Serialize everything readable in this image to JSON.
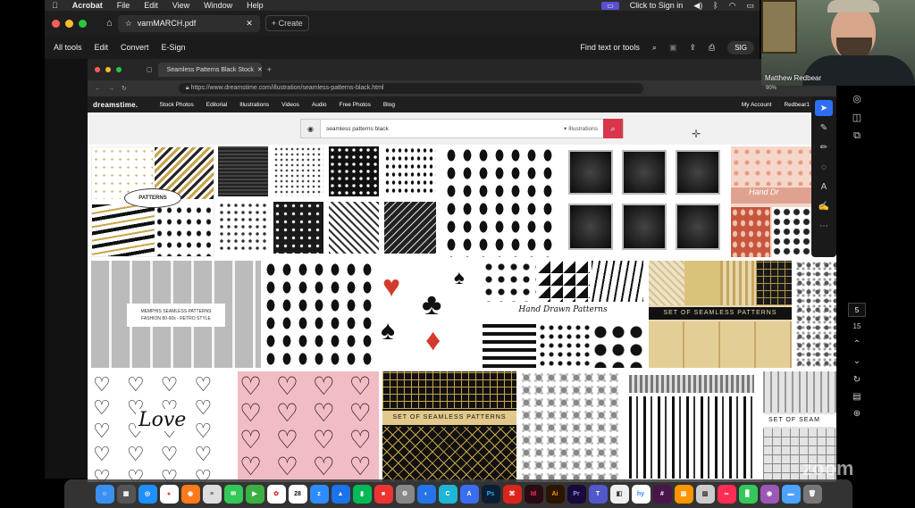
{
  "menubar": {
    "app": "Acrobat",
    "items": [
      "File",
      "Edit",
      "View",
      "Window",
      "Help"
    ],
    "click_to_sign": "Click to Sign in"
  },
  "acrobat": {
    "tab_title": "varnMARCH.pdf",
    "create_label": "Create",
    "tools": [
      "All tools",
      "Edit",
      "Convert",
      "E-Sign"
    ],
    "find_label": "Find text or tools",
    "sign_btn": "SIG"
  },
  "browser": {
    "tab_title": "Seamless Patterns Black Stock",
    "url": "https://www.dreamstime.com/illustration/seamless-patterns-black.html",
    "logo": "dreamstime.",
    "nav": [
      "Stock Photos",
      "Editorial",
      "Illustrations",
      "Videos",
      "Audio",
      "Free Photos",
      "Blog"
    ],
    "nav_right": [
      "My Account",
      "Redbear1"
    ],
    "search_value": "seamless patterns black",
    "search_filter": "Illustrations"
  },
  "tiles": {
    "hand_drawn": "Hand Drawn Patterns",
    "set_seamless": "SET OF SEAMLESS PATTERNS",
    "memphis": "MEMPHIS SEAMLESS PATTERNS",
    "memphis_sub": "FASHION 80-90s - RETRO STYLE",
    "love": "Love",
    "hand_dr_partial": "Hand Dr",
    "set_seam_partial": "SET OF SEAM",
    "patterns_badge": "PATTERNS"
  },
  "rside": {
    "page": "5",
    "total": "15"
  },
  "webcam": {
    "name": "Matthew Redbear",
    "zoom": "90%"
  },
  "watermark": "zoom",
  "dock": {
    "date": "28"
  },
  "colors": {
    "accent": "#d9364c",
    "select": "#2d6ef5"
  }
}
